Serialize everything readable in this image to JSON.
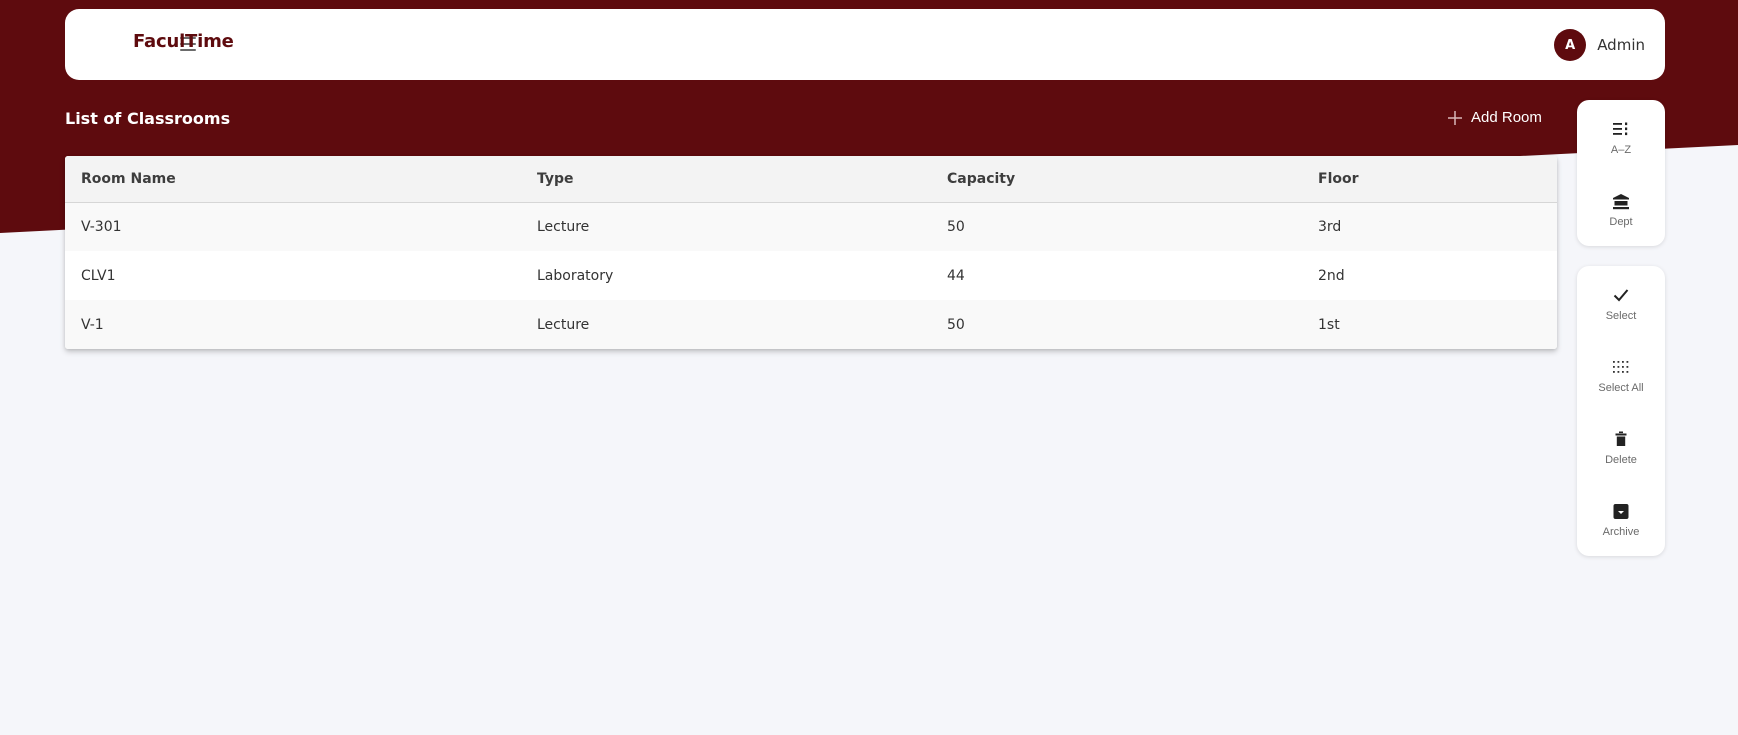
{
  "theme": {
    "accent": "#5e0b0e",
    "background": "#f5f6fa"
  },
  "header": {
    "brand": "FaculTime",
    "menu_icon": "hamburger-menu-icon",
    "user": {
      "initial": "A",
      "name": "Admin"
    }
  },
  "page": {
    "title": "List of Classrooms",
    "add_button": {
      "label": "Add Room",
      "icon": "plus-icon"
    }
  },
  "table": {
    "columns": [
      "Room Name",
      "Type",
      "Capacity",
      "Floor"
    ],
    "rows": [
      [
        "V-301",
        "Lecture",
        "50",
        "3rd"
      ],
      [
        "CLV1",
        "Laboratory",
        "44",
        "2nd"
      ],
      [
        "V-1",
        "Lecture",
        "50",
        "1st"
      ]
    ]
  },
  "sort_panel": [
    {
      "label": "A–Z",
      "icon": "sort-list-icon"
    },
    {
      "label": "Dept",
      "icon": "institution-icon"
    }
  ],
  "action_panel": [
    {
      "label": "Select",
      "icon": "check-icon"
    },
    {
      "label": "Select All",
      "icon": "dots-grid-icon"
    },
    {
      "label": "Delete",
      "icon": "trash-icon"
    },
    {
      "label": "Archive",
      "icon": "archive-box-icon"
    }
  ]
}
